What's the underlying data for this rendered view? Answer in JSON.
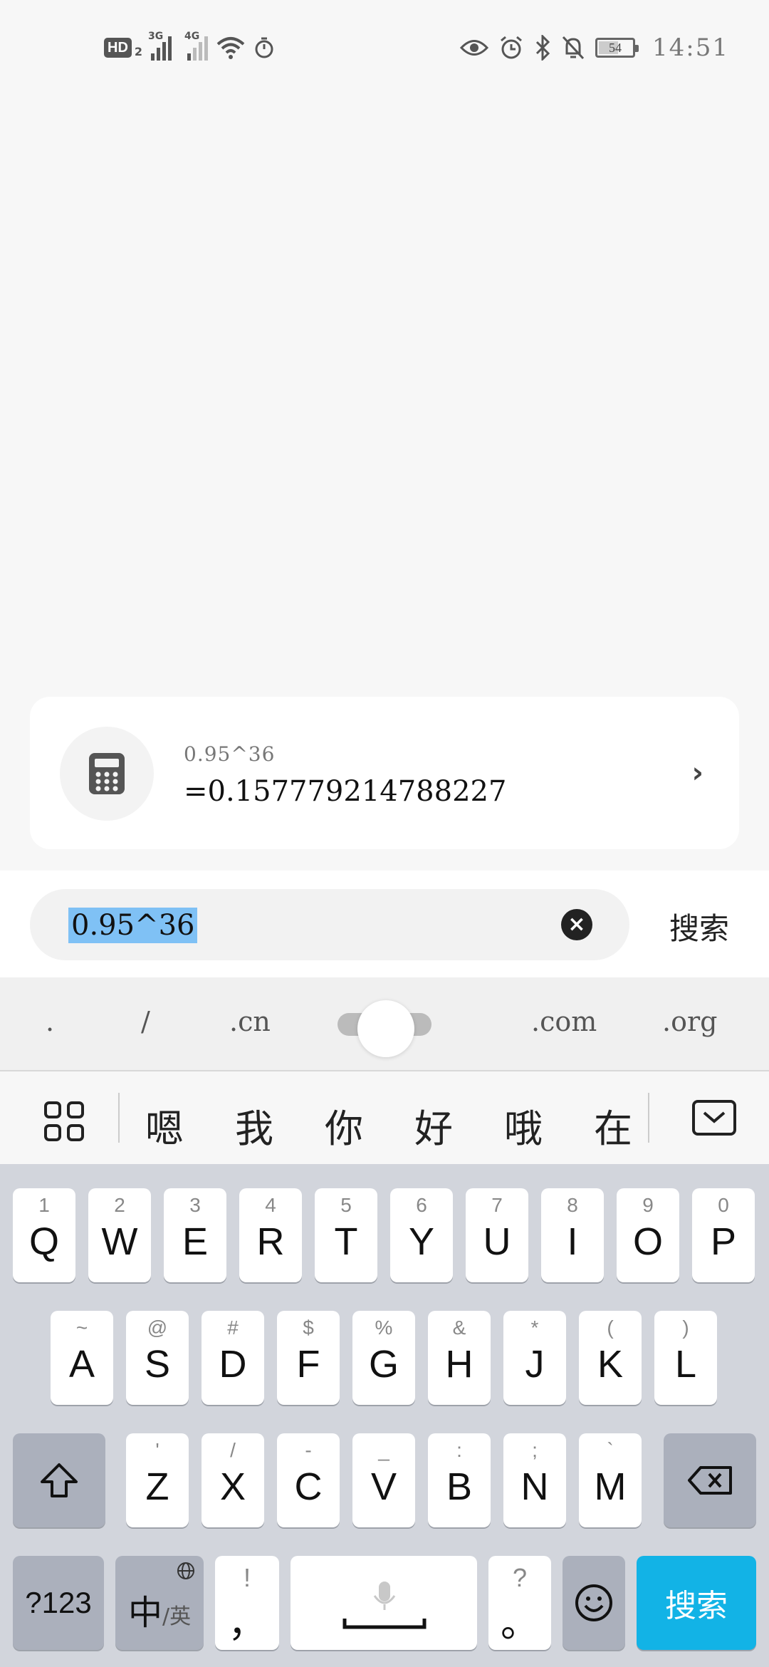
{
  "status_bar": {
    "hd_label": "HD",
    "hd_sub": "2",
    "net1": "3G",
    "net2": "4G",
    "battery": "54",
    "battery_level_percent": 54,
    "time": "14:51",
    "icons": [
      "eye-icon",
      "alarm-icon",
      "bluetooth-icon",
      "mute-icon"
    ]
  },
  "result_card": {
    "icon": "calculator-icon",
    "expression": "0.95^36",
    "result": "=0.157779214788227"
  },
  "search": {
    "query": "0.95^36",
    "button_label": "搜索"
  },
  "keyboard": {
    "shortcuts": [
      ".",
      "/",
      ".cn",
      ".com",
      ".org"
    ],
    "candidates": [
      "嗯",
      "我",
      "你",
      "好",
      "哦",
      "在"
    ],
    "row1": [
      {
        "hint": "1",
        "key": "Q"
      },
      {
        "hint": "2",
        "key": "W"
      },
      {
        "hint": "3",
        "key": "E"
      },
      {
        "hint": "4",
        "key": "R"
      },
      {
        "hint": "5",
        "key": "T"
      },
      {
        "hint": "6",
        "key": "Y"
      },
      {
        "hint": "7",
        "key": "U"
      },
      {
        "hint": "8",
        "key": "I"
      },
      {
        "hint": "9",
        "key": "O"
      },
      {
        "hint": "0",
        "key": "P"
      }
    ],
    "row2": [
      {
        "hint": "~",
        "key": "A"
      },
      {
        "hint": "@",
        "key": "S"
      },
      {
        "hint": "#",
        "key": "D"
      },
      {
        "hint": "$",
        "key": "F"
      },
      {
        "hint": "%",
        "key": "G"
      },
      {
        "hint": "&",
        "key": "H"
      },
      {
        "hint": "*",
        "key": "J"
      },
      {
        "hint": "(",
        "key": "K"
      },
      {
        "hint": ")",
        "key": "L"
      }
    ],
    "row3": [
      {
        "hint": "'",
        "key": "Z"
      },
      {
        "hint": "/",
        "key": "X"
      },
      {
        "hint": "-",
        "key": "C"
      },
      {
        "hint": "_",
        "key": "V"
      },
      {
        "hint": ":",
        "key": "B"
      },
      {
        "hint": ";",
        "key": "N"
      },
      {
        "hint": "`",
        "key": "M"
      }
    ],
    "numbers_label": "?123",
    "lang_main": "中",
    "lang_sub": "/英",
    "comma_hint": "!",
    "comma_key": "，",
    "period_hint": "?",
    "period_key": "。",
    "search_key": "搜索",
    "accent_color": "#12b3e6"
  }
}
